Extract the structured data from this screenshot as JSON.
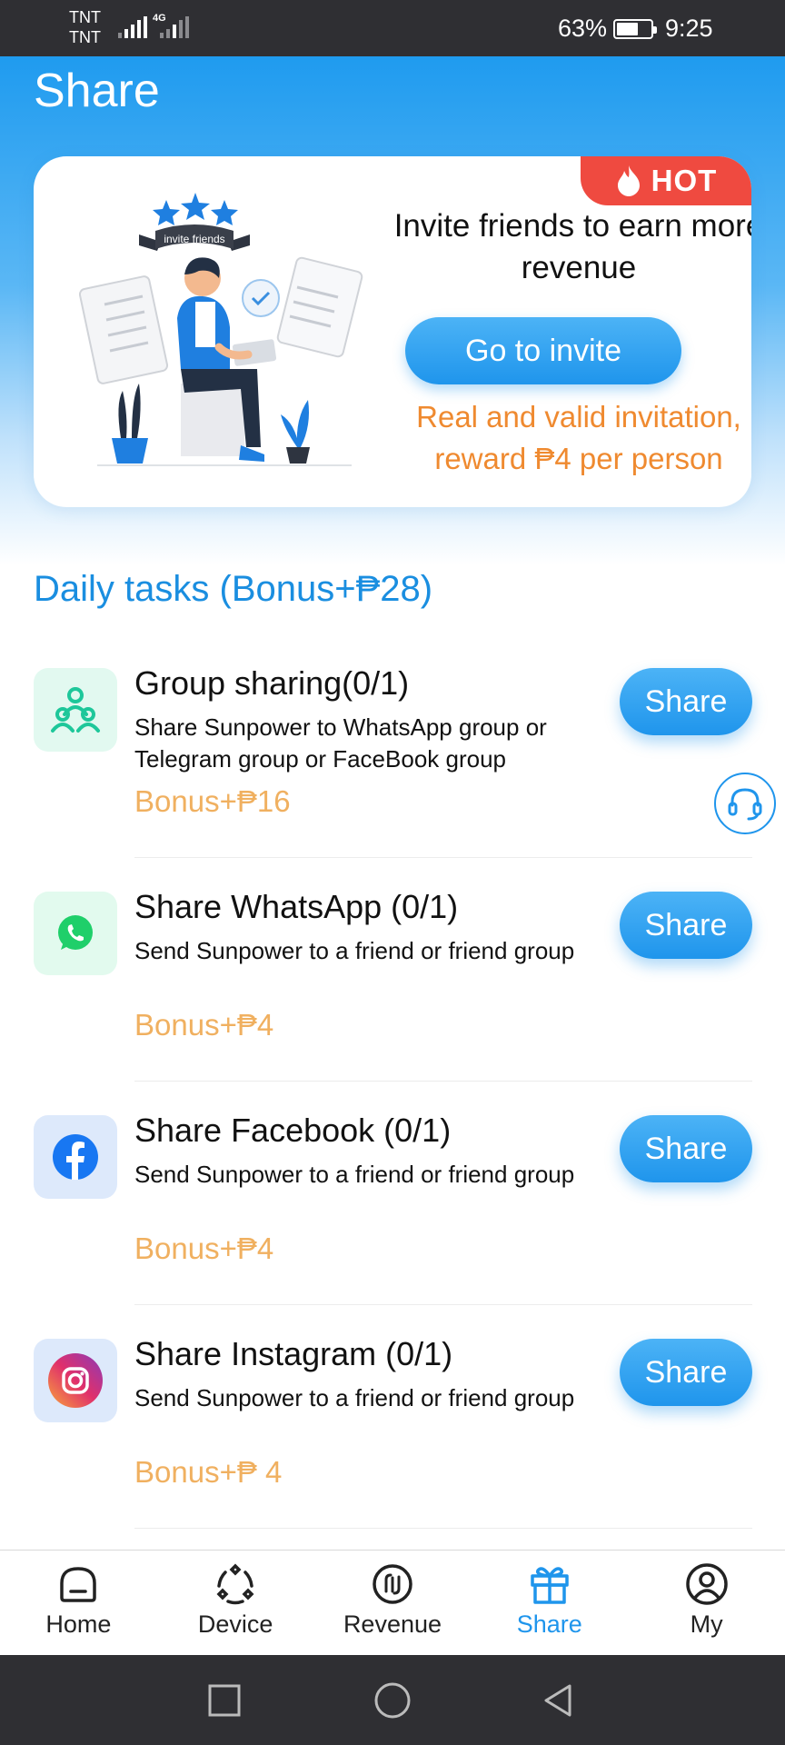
{
  "status_bar": {
    "carrier1": "TNT",
    "carrier2": "TNT",
    "network": "4G",
    "battery_pct": "63%",
    "battery_level": 0.63,
    "time": "9:25"
  },
  "page": {
    "title": "Share"
  },
  "invite_card": {
    "badge": "HOT",
    "illustration_label": "invite friends",
    "headline": "Invite friends to earn more revenue",
    "button": "Go to invite",
    "note": "Real and valid invitation, reward ₱4 per person"
  },
  "daily_tasks": {
    "title": "Daily tasks (Bonus+₱28)",
    "items": [
      {
        "title": "Group sharing(0/1)",
        "desc": "Share Sunpower to WhatsApp group or Telegram group or FaceBook group",
        "bonus": "Bonus+₱16",
        "button": "Share",
        "icon": "group-icon",
        "color": "#1ec79a"
      },
      {
        "title": "Share WhatsApp (0/1)",
        "desc": "Send Sunpower to a friend or friend group",
        "bonus": "Bonus+₱4",
        "button": "Share",
        "icon": "whatsapp-icon",
        "color": "#1fcf6a"
      },
      {
        "title": "Share Facebook (0/1)",
        "desc": "Send Sunpower to a friend or friend group",
        "bonus": "Bonus+₱4",
        "button": "Share",
        "icon": "facebook-icon",
        "color": "#1877f2"
      },
      {
        "title": "Share Instagram (0/1)",
        "desc": "Send Sunpower to a friend or friend group",
        "bonus": "Bonus+₱ 4",
        "button": "Share",
        "icon": "instagram-icon",
        "color": "#d6246f"
      }
    ]
  },
  "bottom_nav": {
    "active": "Share",
    "active_color": "#1f95ec",
    "items": [
      {
        "label": "Home",
        "icon": "home-icon"
      },
      {
        "label": "Device",
        "icon": "device-icon"
      },
      {
        "label": "Revenue",
        "icon": "revenue-icon"
      },
      {
        "label": "Share",
        "icon": "gift-icon"
      },
      {
        "label": "My",
        "icon": "user-icon"
      }
    ]
  },
  "colors": {
    "primary": "#1f95ec",
    "hot_badge": "#ef4a40",
    "bonus": "#f0b060",
    "note": "#ef8a30"
  }
}
